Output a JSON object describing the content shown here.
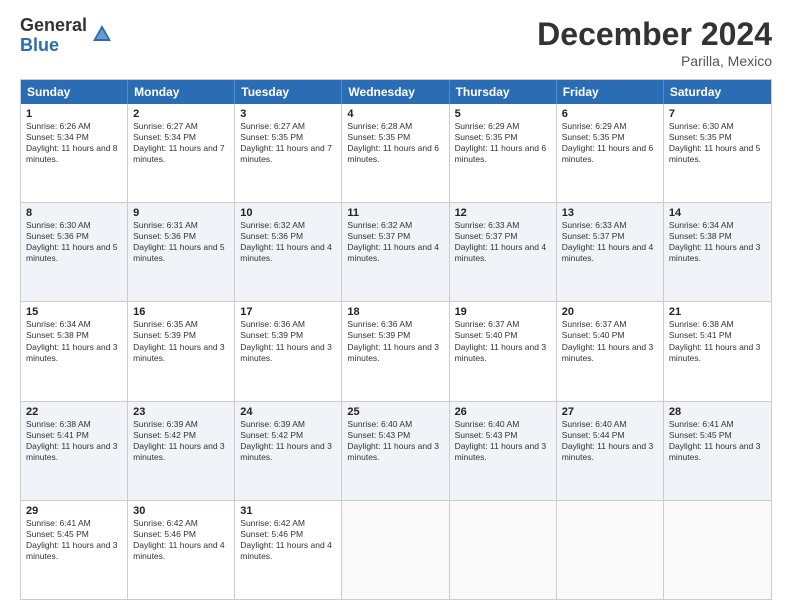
{
  "logo": {
    "general": "General",
    "blue": "Blue"
  },
  "title": "December 2024",
  "subtitle": "Parilla, Mexico",
  "header_days": [
    "Sunday",
    "Monday",
    "Tuesday",
    "Wednesday",
    "Thursday",
    "Friday",
    "Saturday"
  ],
  "weeks": [
    [
      {
        "day": "1",
        "sunrise": "Sunrise: 6:26 AM",
        "sunset": "Sunset: 5:34 PM",
        "daylight": "Daylight: 11 hours and 8 minutes."
      },
      {
        "day": "2",
        "sunrise": "Sunrise: 6:27 AM",
        "sunset": "Sunset: 5:34 PM",
        "daylight": "Daylight: 11 hours and 7 minutes."
      },
      {
        "day": "3",
        "sunrise": "Sunrise: 6:27 AM",
        "sunset": "Sunset: 5:35 PM",
        "daylight": "Daylight: 11 hours and 7 minutes."
      },
      {
        "day": "4",
        "sunrise": "Sunrise: 6:28 AM",
        "sunset": "Sunset: 5:35 PM",
        "daylight": "Daylight: 11 hours and 6 minutes."
      },
      {
        "day": "5",
        "sunrise": "Sunrise: 6:29 AM",
        "sunset": "Sunset: 5:35 PM",
        "daylight": "Daylight: 11 hours and 6 minutes."
      },
      {
        "day": "6",
        "sunrise": "Sunrise: 6:29 AM",
        "sunset": "Sunset: 5:35 PM",
        "daylight": "Daylight: 11 hours and 6 minutes."
      },
      {
        "day": "7",
        "sunrise": "Sunrise: 6:30 AM",
        "sunset": "Sunset: 5:35 PM",
        "daylight": "Daylight: 11 hours and 5 minutes."
      }
    ],
    [
      {
        "day": "8",
        "sunrise": "Sunrise: 6:30 AM",
        "sunset": "Sunset: 5:36 PM",
        "daylight": "Daylight: 11 hours and 5 minutes."
      },
      {
        "day": "9",
        "sunrise": "Sunrise: 6:31 AM",
        "sunset": "Sunset: 5:36 PM",
        "daylight": "Daylight: 11 hours and 5 minutes."
      },
      {
        "day": "10",
        "sunrise": "Sunrise: 6:32 AM",
        "sunset": "Sunset: 5:36 PM",
        "daylight": "Daylight: 11 hours and 4 minutes."
      },
      {
        "day": "11",
        "sunrise": "Sunrise: 6:32 AM",
        "sunset": "Sunset: 5:37 PM",
        "daylight": "Daylight: 11 hours and 4 minutes."
      },
      {
        "day": "12",
        "sunrise": "Sunrise: 6:33 AM",
        "sunset": "Sunset: 5:37 PM",
        "daylight": "Daylight: 11 hours and 4 minutes."
      },
      {
        "day": "13",
        "sunrise": "Sunrise: 6:33 AM",
        "sunset": "Sunset: 5:37 PM",
        "daylight": "Daylight: 11 hours and 4 minutes."
      },
      {
        "day": "14",
        "sunrise": "Sunrise: 6:34 AM",
        "sunset": "Sunset: 5:38 PM",
        "daylight": "Daylight: 11 hours and 3 minutes."
      }
    ],
    [
      {
        "day": "15",
        "sunrise": "Sunrise: 6:34 AM",
        "sunset": "Sunset: 5:38 PM",
        "daylight": "Daylight: 11 hours and 3 minutes."
      },
      {
        "day": "16",
        "sunrise": "Sunrise: 6:35 AM",
        "sunset": "Sunset: 5:39 PM",
        "daylight": "Daylight: 11 hours and 3 minutes."
      },
      {
        "day": "17",
        "sunrise": "Sunrise: 6:36 AM",
        "sunset": "Sunset: 5:39 PM",
        "daylight": "Daylight: 11 hours and 3 minutes."
      },
      {
        "day": "18",
        "sunrise": "Sunrise: 6:36 AM",
        "sunset": "Sunset: 5:39 PM",
        "daylight": "Daylight: 11 hours and 3 minutes."
      },
      {
        "day": "19",
        "sunrise": "Sunrise: 6:37 AM",
        "sunset": "Sunset: 5:40 PM",
        "daylight": "Daylight: 11 hours and 3 minutes."
      },
      {
        "day": "20",
        "sunrise": "Sunrise: 6:37 AM",
        "sunset": "Sunset: 5:40 PM",
        "daylight": "Daylight: 11 hours and 3 minutes."
      },
      {
        "day": "21",
        "sunrise": "Sunrise: 6:38 AM",
        "sunset": "Sunset: 5:41 PM",
        "daylight": "Daylight: 11 hours and 3 minutes."
      }
    ],
    [
      {
        "day": "22",
        "sunrise": "Sunrise: 6:38 AM",
        "sunset": "Sunset: 5:41 PM",
        "daylight": "Daylight: 11 hours and 3 minutes."
      },
      {
        "day": "23",
        "sunrise": "Sunrise: 6:39 AM",
        "sunset": "Sunset: 5:42 PM",
        "daylight": "Daylight: 11 hours and 3 minutes."
      },
      {
        "day": "24",
        "sunrise": "Sunrise: 6:39 AM",
        "sunset": "Sunset: 5:42 PM",
        "daylight": "Daylight: 11 hours and 3 minutes."
      },
      {
        "day": "25",
        "sunrise": "Sunrise: 6:40 AM",
        "sunset": "Sunset: 5:43 PM",
        "daylight": "Daylight: 11 hours and 3 minutes."
      },
      {
        "day": "26",
        "sunrise": "Sunrise: 6:40 AM",
        "sunset": "Sunset: 5:43 PM",
        "daylight": "Daylight: 11 hours and 3 minutes."
      },
      {
        "day": "27",
        "sunrise": "Sunrise: 6:40 AM",
        "sunset": "Sunset: 5:44 PM",
        "daylight": "Daylight: 11 hours and 3 minutes."
      },
      {
        "day": "28",
        "sunrise": "Sunrise: 6:41 AM",
        "sunset": "Sunset: 5:45 PM",
        "daylight": "Daylight: 11 hours and 3 minutes."
      }
    ],
    [
      {
        "day": "29",
        "sunrise": "Sunrise: 6:41 AM",
        "sunset": "Sunset: 5:45 PM",
        "daylight": "Daylight: 11 hours and 3 minutes."
      },
      {
        "day": "30",
        "sunrise": "Sunrise: 6:42 AM",
        "sunset": "Sunset: 5:46 PM",
        "daylight": "Daylight: 11 hours and 4 minutes."
      },
      {
        "day": "31",
        "sunrise": "Sunrise: 6:42 AM",
        "sunset": "Sunset: 5:46 PM",
        "daylight": "Daylight: 11 hours and 4 minutes."
      },
      null,
      null,
      null,
      null
    ]
  ]
}
